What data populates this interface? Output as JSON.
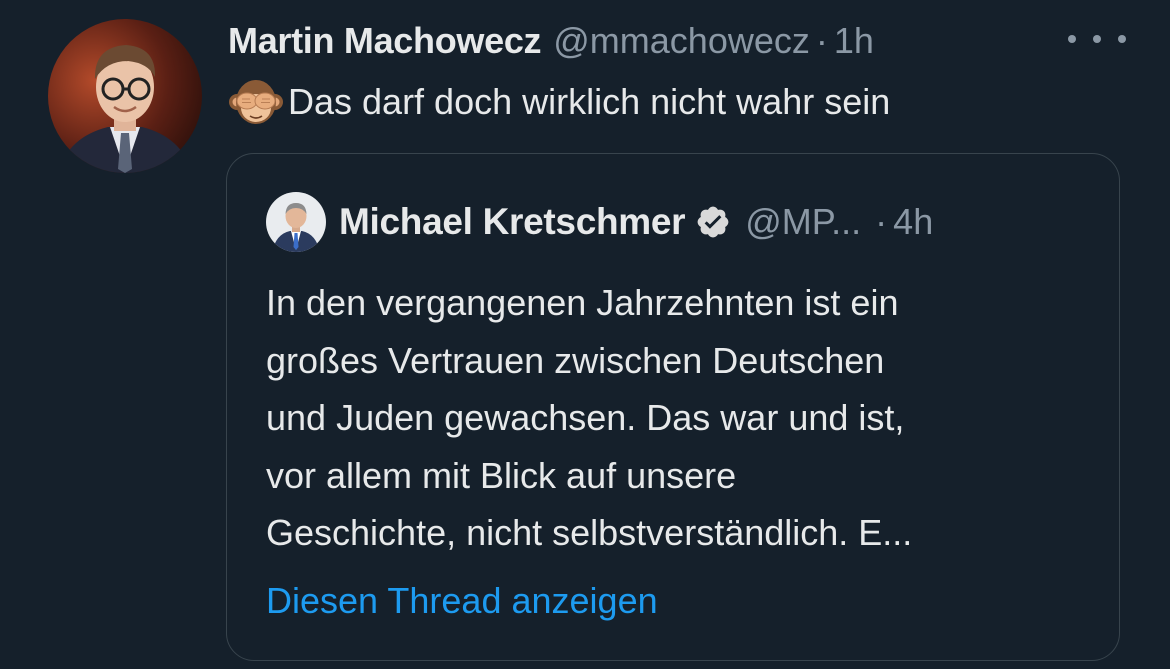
{
  "tweet": {
    "author": {
      "name": "Martin Machowecz",
      "handle": "@mmachowecz",
      "separator": "·",
      "time": "1h",
      "avatar_icon": "person-portrait-avatar"
    },
    "more_icon": "more-horizontal-icon",
    "emoji": "🙈",
    "text": "Das darf doch wirklich nicht wahr sein"
  },
  "quote": {
    "author": {
      "name": "Michael Kretschmer",
      "verified": true,
      "verified_icon": "verified-badge-icon",
      "handle": "@MP...",
      "separator": "·",
      "time": "4h",
      "avatar_icon": "person-portrait-avatar"
    },
    "text": "In den vergangenen Jahrzehnten ist ein\ngroßes Vertrauen zwischen Deutschen\nund Juden gewachsen. Das war und ist,\nvor allem mit Blick auf unsere\nGeschichte, nicht selbstverständlich. E...",
    "thread_link": "Diesen Thread anzeigen"
  },
  "colors": {
    "background": "#15202b",
    "primary_text": "#e7e9ea",
    "secondary_text": "#8b98a5",
    "link": "#1d9bf0",
    "border": "#38444d"
  }
}
